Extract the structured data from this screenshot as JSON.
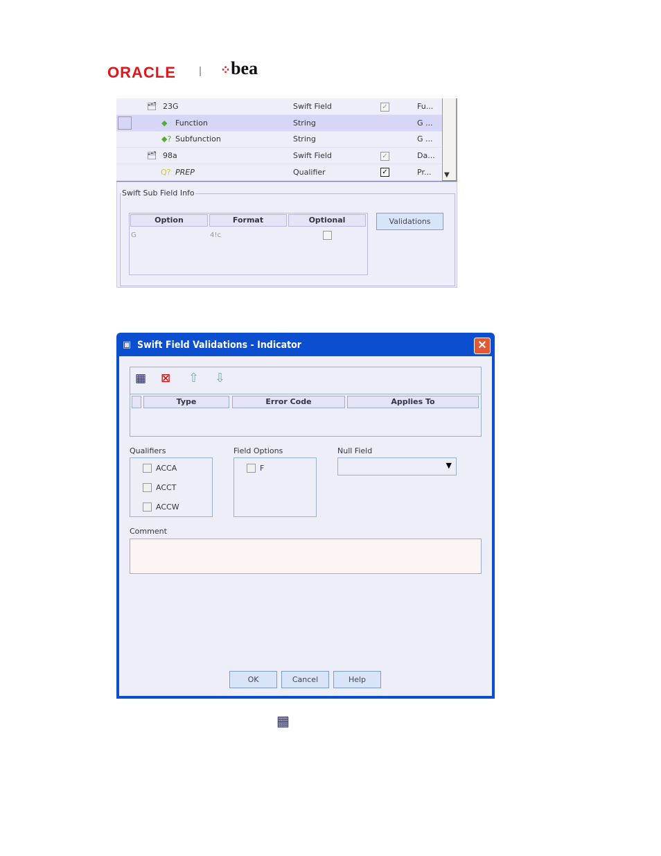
{
  "logo": {
    "oracle": "ORACLE",
    "bea": "bea"
  },
  "tree": {
    "rows": [
      {
        "name": "23G",
        "type": "Swift Field",
        "checked": true,
        "enabled": false,
        "extra": "Fu..."
      },
      {
        "name": "Function",
        "type": "String",
        "extra": "G ...",
        "selected": true
      },
      {
        "name": "Subfunction",
        "type": "String",
        "extra": "G ..."
      },
      {
        "name": "98a",
        "type": "Swift Field",
        "checked": true,
        "enabled": false,
        "extra": "Da..."
      },
      {
        "name": "PREP",
        "type": "Qualifier",
        "checked": true,
        "enabled": true,
        "extra": "Pr..."
      }
    ]
  },
  "subfield": {
    "legend": "Swift Sub Field Info",
    "columns": [
      "Option",
      "Format",
      "Optional"
    ],
    "row": {
      "option": "G",
      "format": "4!c"
    },
    "validations": "Validations"
  },
  "dialog": {
    "title": "Swift Field Validations - Indicator",
    "columns": [
      "Type",
      "Error Code",
      "Applies To"
    ],
    "qualifiers_label": "Qualifiers",
    "qualifiers": [
      "ACCA",
      "ACCT",
      "ACCW"
    ],
    "field_options_label": "Field Options",
    "field_options": [
      "F"
    ],
    "null_field_label": "Null Field",
    "null_field_value": "",
    "comment_label": "Comment",
    "comment_value": "",
    "ok": "OK",
    "cancel": "Cancel",
    "help": "Help"
  }
}
